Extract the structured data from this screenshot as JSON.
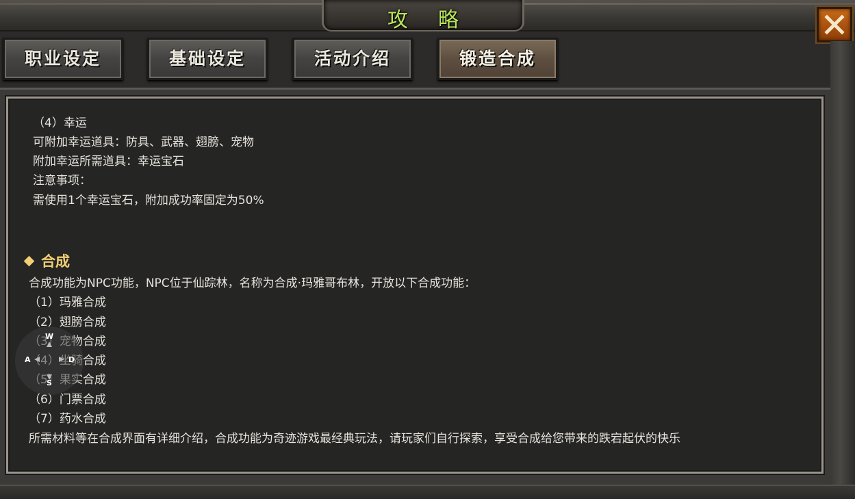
{
  "window": {
    "title": "攻略",
    "close_icon": "close-icon"
  },
  "tabs": [
    {
      "label": "职业设定",
      "active": false
    },
    {
      "label": "基础设定",
      "active": false
    },
    {
      "label": "活动介绍",
      "active": false
    },
    {
      "label": "锻造合成",
      "active": true
    }
  ],
  "content": {
    "luck_lines": [
      "（4）幸运",
      "可附加幸运道具：防具、武器、翅膀、宠物",
      "附加幸运所需道具：幸运宝石",
      "注意事项：",
      "需使用1个幸运宝石，附加成功率固定为50%"
    ],
    "synthesis_heading": "合成",
    "synthesis_intro": "合成功能为NPC功能，NPC位于仙踪林，名称为合成·玛雅哥布林，开放以下合成功能：",
    "synthesis_items": [
      "（1）玛雅合成",
      "（2）翅膀合成",
      "（3）宠物合成",
      "（4）坐骑合成",
      "（5）果实合成",
      "（6）门票合成",
      "（7）药水合成"
    ],
    "synthesis_footer": "所需材料等在合成界面有详细介绍，合成功能为奇迹游戏最经典玩法，请玩家们自行探索，享受合成给您带来的跌宕起伏的快乐"
  },
  "joystick": {
    "up": "W",
    "left": "A",
    "right": "D",
    "down": "S"
  },
  "colors": {
    "title": "#b9e55a",
    "heading": "#f2cf74",
    "text": "#e6e3dc",
    "close_button": "#c96a17"
  }
}
